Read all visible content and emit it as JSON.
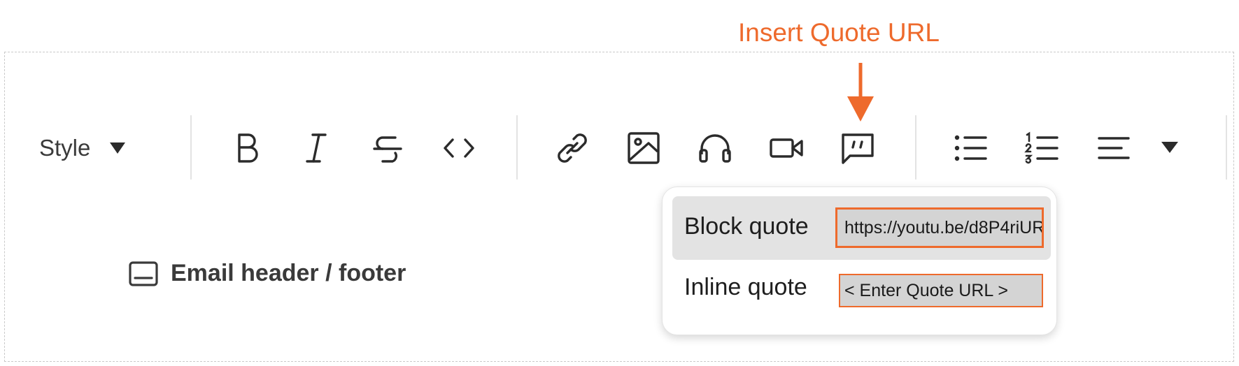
{
  "annotation": {
    "label": "Insert Quote URL",
    "color": "#ee6a2c"
  },
  "toolbar": {
    "style_label": "Style",
    "buttons": [
      {
        "name": "bold",
        "icon": "bold-icon"
      },
      {
        "name": "italic",
        "icon": "italic-icon"
      },
      {
        "name": "strikethrough",
        "icon": "strikethrough-icon"
      },
      {
        "name": "code",
        "icon": "code-icon"
      },
      {
        "name": "link",
        "icon": "link-icon"
      },
      {
        "name": "image",
        "icon": "image-icon"
      },
      {
        "name": "audio",
        "icon": "headphones-icon"
      },
      {
        "name": "video",
        "icon": "video-camera-icon"
      },
      {
        "name": "quote",
        "icon": "quote-bubble-icon"
      },
      {
        "name": "bullet-list",
        "icon": "bullet-list-icon"
      },
      {
        "name": "numbered-list",
        "icon": "numbered-list-icon"
      },
      {
        "name": "align",
        "icon": "align-left-icon"
      }
    ]
  },
  "content": {
    "email_header_footer_label": "Email header / footer"
  },
  "quote_menu": {
    "items": [
      {
        "label": "Block quote",
        "url_value": "https://youtu.be/d8P4riUR",
        "highlighted": true
      },
      {
        "label": "Inline quote",
        "url_placeholder": "< Enter Quote URL >",
        "highlighted": false
      }
    ]
  }
}
